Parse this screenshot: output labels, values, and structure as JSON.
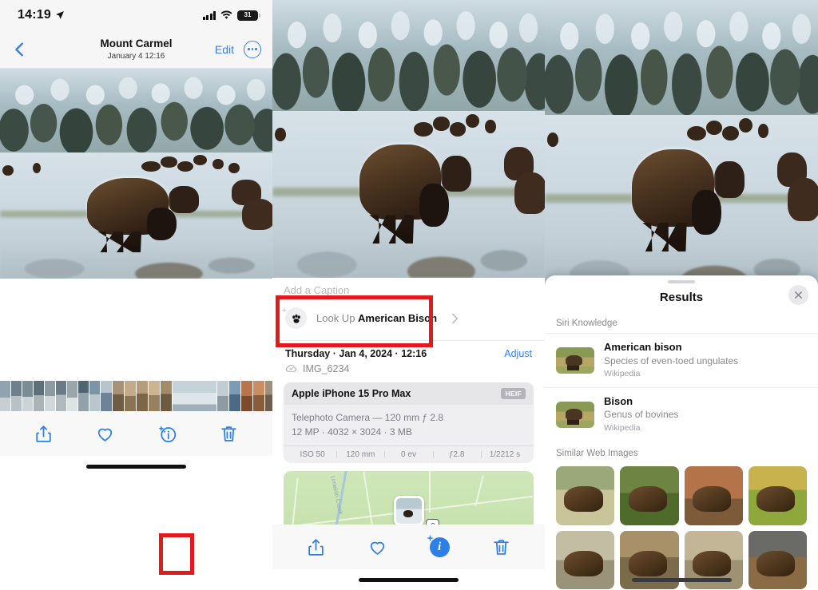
{
  "panel1": {
    "status": {
      "time": "14:19",
      "battery": "31",
      "location_icon": "location-arrow-icon",
      "signal_icon": "cellular-bars-icon",
      "wifi_icon": "wifi-icon"
    },
    "nav": {
      "back_icon": "chevron-left-icon",
      "title": "Mount Carmel",
      "subtitle": "January 4  12:16",
      "edit_label": "Edit",
      "more_icon": "ellipsis-circle-icon"
    },
    "toolbar": {
      "share_icon": "share-icon",
      "favorite_icon": "heart-icon",
      "info_icon": "info-sparkle-icon",
      "delete_icon": "trash-icon"
    }
  },
  "panel2": {
    "caption_placeholder": "Add a Caption",
    "lookup": {
      "icon": "paw-print-icon",
      "prefix": "Look Up ",
      "subject": "American Bison",
      "chevron_icon": "chevron-right-icon"
    },
    "date_line": "Thursday · Jan 4, 2024 · 12:16",
    "adjust_label": "Adjust",
    "cloud_icon": "cloud-check-icon",
    "file_name": "IMG_6234",
    "exif": {
      "model": "Apple iPhone 15 Pro Max",
      "format_badge": "HEIF",
      "lens_line": "Telephoto Camera — 120 mm ƒ 2.8",
      "spec_line": "12 MP · 4032 × 3024 · 3 MB",
      "stats": [
        "ISO 50",
        "120 mm",
        "0 ev",
        "ƒ2.8",
        "1/2212 s"
      ]
    },
    "map": {
      "creek_label": "Limekiln Creek",
      "pin_icon": "photo-pin-icon",
      "marker_icon": "poi-marker-icon"
    },
    "toolbar": {
      "share_icon": "share-icon",
      "favorite_icon": "heart-icon",
      "info_icon": "info-sparkle-icon-active",
      "delete_icon": "trash-icon"
    }
  },
  "panel3": {
    "sheet_title": "Results",
    "close_icon": "close-icon",
    "grabber_icon": "sheet-grabber",
    "sections": {
      "knowledge": "Siri Knowledge",
      "images": "Similar Web Images"
    },
    "knowledge_items": [
      {
        "title": "American bison",
        "subtitle": "Species of even-toed ungulates",
        "source": "Wikipedia"
      },
      {
        "title": "Bison",
        "subtitle": "Genus of bovines",
        "source": "Wikipedia"
      }
    ],
    "web_images": [
      {
        "bg": "linear-gradient(#9aa87a 0 40%, #c9c49a 40% 100%)"
      },
      {
        "bg": "linear-gradient(#6d8442 0 45%, #4e6b2c 45% 100%)"
      },
      {
        "bg": "linear-gradient(#b5734a 0 55%, #7d5a3a 55% 100%)"
      },
      {
        "bg": "linear-gradient(#c8b24e 0 40%, #8fa83c 40% 100%)"
      },
      {
        "bg": "linear-gradient(#c3bda4 0 50%, #9a9379 50% 100%)"
      },
      {
        "bg": "linear-gradient(#a89068 0 45%, #7b6b4a 45% 100%)"
      },
      {
        "bg": "linear-gradient(#c2b697 0 50%, #9e9272 50% 100%)"
      },
      {
        "bg": "linear-gradient(#6a6a66 0 45%, #8a6b46 45% 100%)"
      }
    ]
  },
  "colors": {
    "accent": "#2f7fe8",
    "annotation": "#e01b1b",
    "sheet_bg": "#ffffff"
  }
}
